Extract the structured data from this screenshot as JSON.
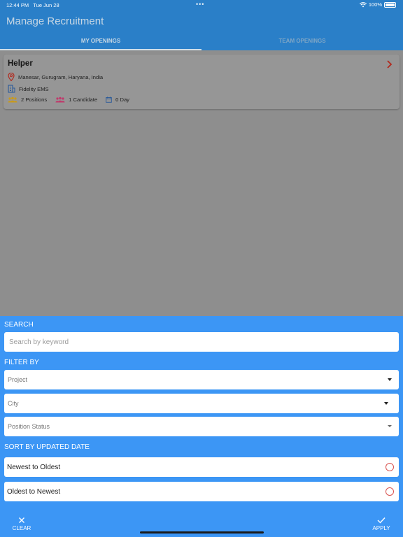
{
  "status_bar": {
    "time": "12:44 PM",
    "date": "Tue Jun 28",
    "dots": "•••",
    "battery": "100%"
  },
  "app": {
    "title": "Manage Recruitment"
  },
  "tabs": [
    {
      "label": "MY OPENINGS"
    },
    {
      "label": "TEAM OPENINGS"
    }
  ],
  "opening": {
    "title": "Helper",
    "location": "Manesar, Gurugram, Haryana, India",
    "company": "Fidelity EMS",
    "positions": "2 Positions",
    "candidates": "1 Candidate",
    "days": "0 Day"
  },
  "filter_sheet": {
    "search_label": "SEARCH",
    "search_placeholder": "Search by keyword",
    "filter_label": "FILTER BY",
    "project": "Project",
    "city": "City",
    "position_status": "Position Status",
    "sort_label": "SORT BY UPDATED DATE",
    "sort_options": [
      {
        "label": "Newest to Oldest"
      },
      {
        "label": "Oldest to Newest"
      }
    ],
    "clear_label": "CLEAR",
    "apply_label": "APPLY"
  },
  "colors": {
    "primary": "#2a7fc8",
    "sheet": "#3c96f5",
    "radio": "#d9534f",
    "accent_red": "#c0392b"
  }
}
